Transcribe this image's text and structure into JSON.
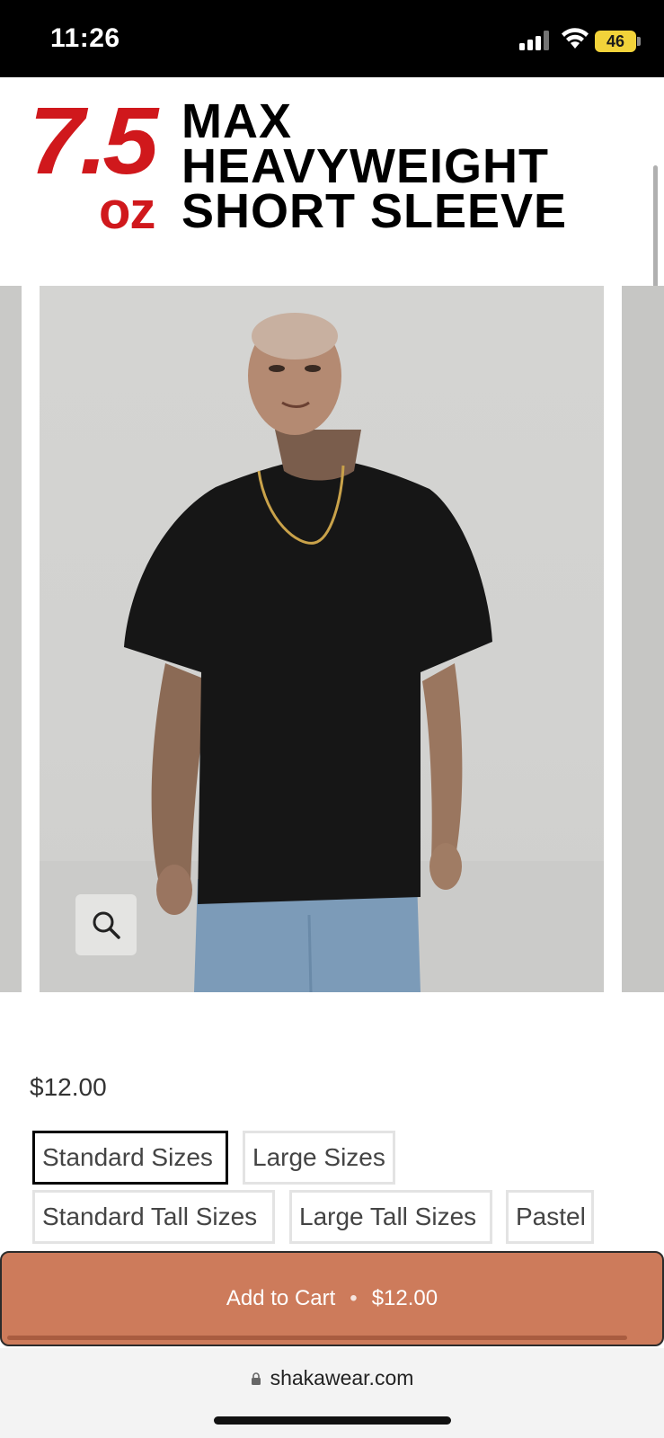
{
  "status_bar": {
    "time": "11:26",
    "battery": "46"
  },
  "banner": {
    "weight_number": "7.5",
    "weight_unit": "oz",
    "line1": "MAX",
    "line2": "HEAVYWEIGHT",
    "line3": "SHORT SLEEVE",
    "accent_color": "#d0181c"
  },
  "gallery": {
    "zoom_icon": "magnifier-icon"
  },
  "product": {
    "price": "$12.00",
    "options": [
      {
        "label": "Standard Sizes",
        "selected": true
      },
      {
        "label": "Large Sizes",
        "selected": false
      },
      {
        "label": "Standard Tall Sizes",
        "selected": false
      },
      {
        "label": "Large Tall Sizes",
        "selected": false
      },
      {
        "label": "Pastel",
        "selected": false
      }
    ]
  },
  "cart": {
    "label": "Add to Cart",
    "separator": "•",
    "price": "$12.00",
    "button_color": "#cd7b5b"
  },
  "browser": {
    "url": "shakawear.com"
  }
}
